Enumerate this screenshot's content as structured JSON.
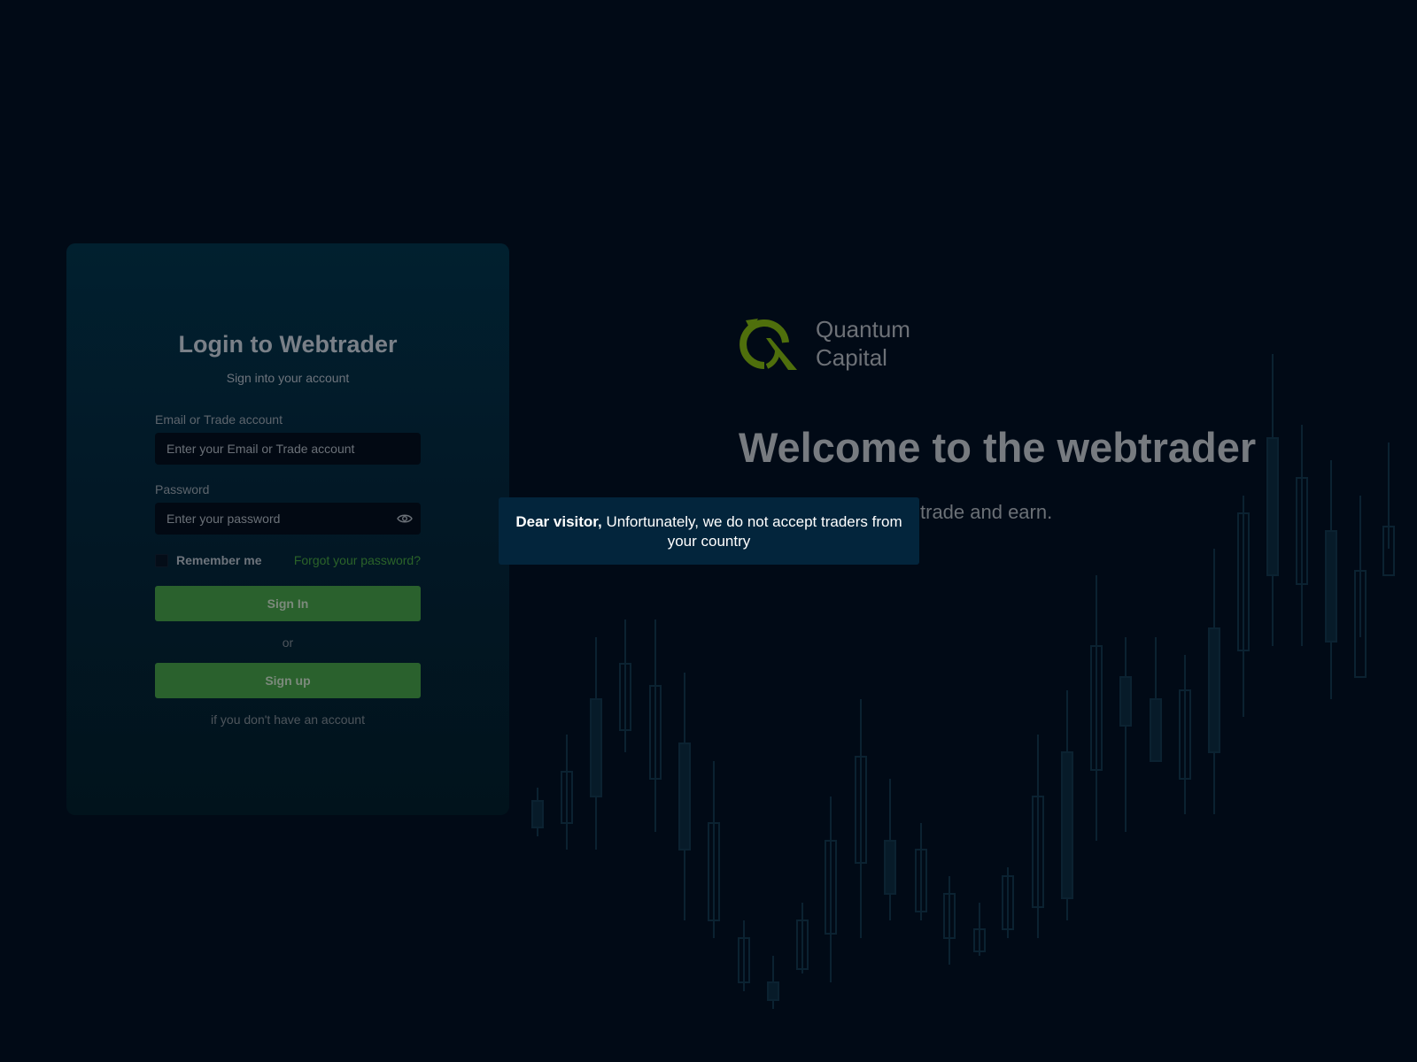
{
  "login": {
    "title": "Login to Webtrader",
    "subtitle": "Sign into your account",
    "email_label": "Email or Trade account",
    "email_placeholder": "Enter your Email or Trade account",
    "password_label": "Password",
    "password_placeholder": "Enter your password",
    "remember_label": "Remember me",
    "remember_checked": false,
    "forgot_link": "Forgot your password?",
    "signin_label": "Sign In",
    "or_text": "or",
    "signup_label": "Sign up",
    "no_account_text": "if you don't have an account"
  },
  "brand": {
    "line1": "Quantum",
    "line2": "Capital",
    "accent_color": "#4f6f0c"
  },
  "hero": {
    "welcome": "Welcome to the webtrader",
    "tagline": "trade and earn."
  },
  "notice": {
    "greeting": "Dear visitor,",
    "message": "Unfortunately, we do not accept traders from your country"
  },
  "colors": {
    "background": "#010a16",
    "card": "#01202f",
    "button": "#2a612d",
    "notice_bg": "#03253c"
  }
}
